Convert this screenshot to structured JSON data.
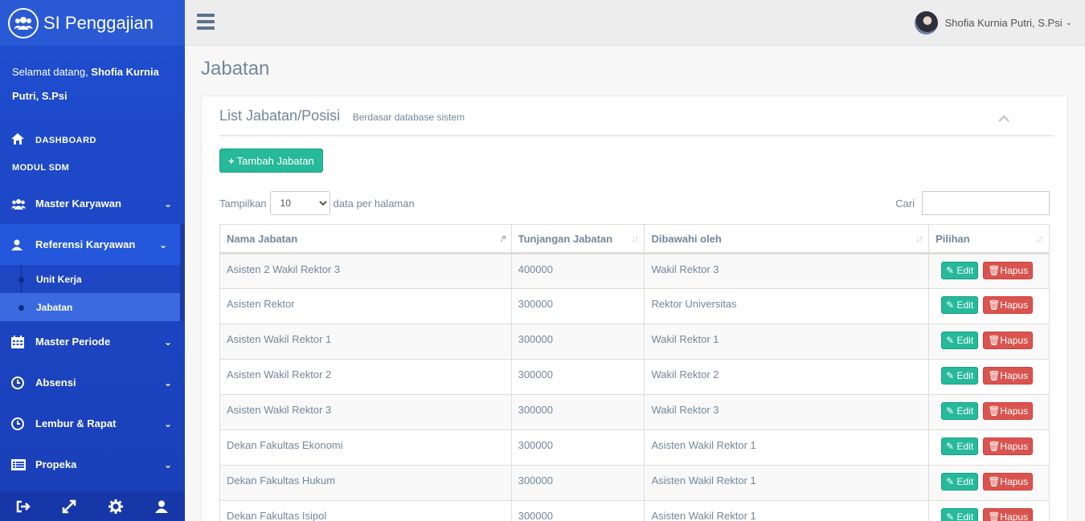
{
  "app": {
    "title": "SI Penggajian"
  },
  "sidebar": {
    "welcome_prefix": "Selamat datang, ",
    "welcome_name": "Shofia Kurnia Putri, S.Psi",
    "dashboard_label": "DASHBOARD",
    "section_title": "MODUL SDM",
    "items": [
      {
        "label": "Master Karyawan",
        "icon": "users-icon"
      },
      {
        "label": "Referensi Karyawan",
        "icon": "user-icon",
        "active": true,
        "children": [
          {
            "label": "Unit Kerja"
          },
          {
            "label": "Jabatan",
            "current": true
          }
        ]
      },
      {
        "label": "Master Periode",
        "icon": "calendar-icon"
      },
      {
        "label": "Absensi",
        "icon": "clock-icon"
      },
      {
        "label": "Lembur & Rapat",
        "icon": "clock-icon"
      },
      {
        "label": "Propeka",
        "icon": "table-icon"
      }
    ],
    "footer_icons": [
      "logout-icon",
      "fullscreen-icon",
      "gear-icon",
      "user-icon"
    ]
  },
  "topnav": {
    "user_name": "Shofia Kurnia Putri, S.Psi"
  },
  "page": {
    "title": "Jabatan",
    "panel_title": "List Jabatan/Posisi",
    "panel_subtitle": "Berdasar database sistem",
    "add_button": "Tambah Jabatan",
    "length_prefix": "Tampilkan",
    "length_value": "10",
    "length_suffix": "data per halaman",
    "search_label": "Cari",
    "search_value": ""
  },
  "table": {
    "headers": [
      "Nama Jabatan",
      "Tunjangan Jabatan",
      "Dibawahi oleh",
      "Pilihan"
    ],
    "edit_label": "Edit",
    "delete_label": "Hapus",
    "rows": [
      [
        "Asisten 2 Wakil Rektor 3",
        "400000",
        "Wakil Rektor 3"
      ],
      [
        "Asisten Rektor",
        "300000",
        "Rektor Universitas"
      ],
      [
        "Asisten Wakil Rektor 1",
        "300000",
        "Wakil Rektor 1"
      ],
      [
        "Asisten Wakil Rektor 2",
        "300000",
        "Wakil Rektor 2"
      ],
      [
        "Asisten Wakil Rektor 3",
        "300000",
        "Wakil Rektor 3"
      ],
      [
        "Dekan Fakultas Ekonomi",
        "300000",
        "Asisten Wakil Rektor 1"
      ],
      [
        "Dekan Fakultas Hukum",
        "300000",
        "Asisten Wakil Rektor 1"
      ],
      [
        "Dekan Fakultas Isipol",
        "300000",
        "Asisten Wakil Rektor 1"
      ]
    ]
  },
  "colors": {
    "sidebar": "#1f4fd0",
    "success": "#26B99A",
    "danger": "#d9534f",
    "text": "#73879C"
  }
}
